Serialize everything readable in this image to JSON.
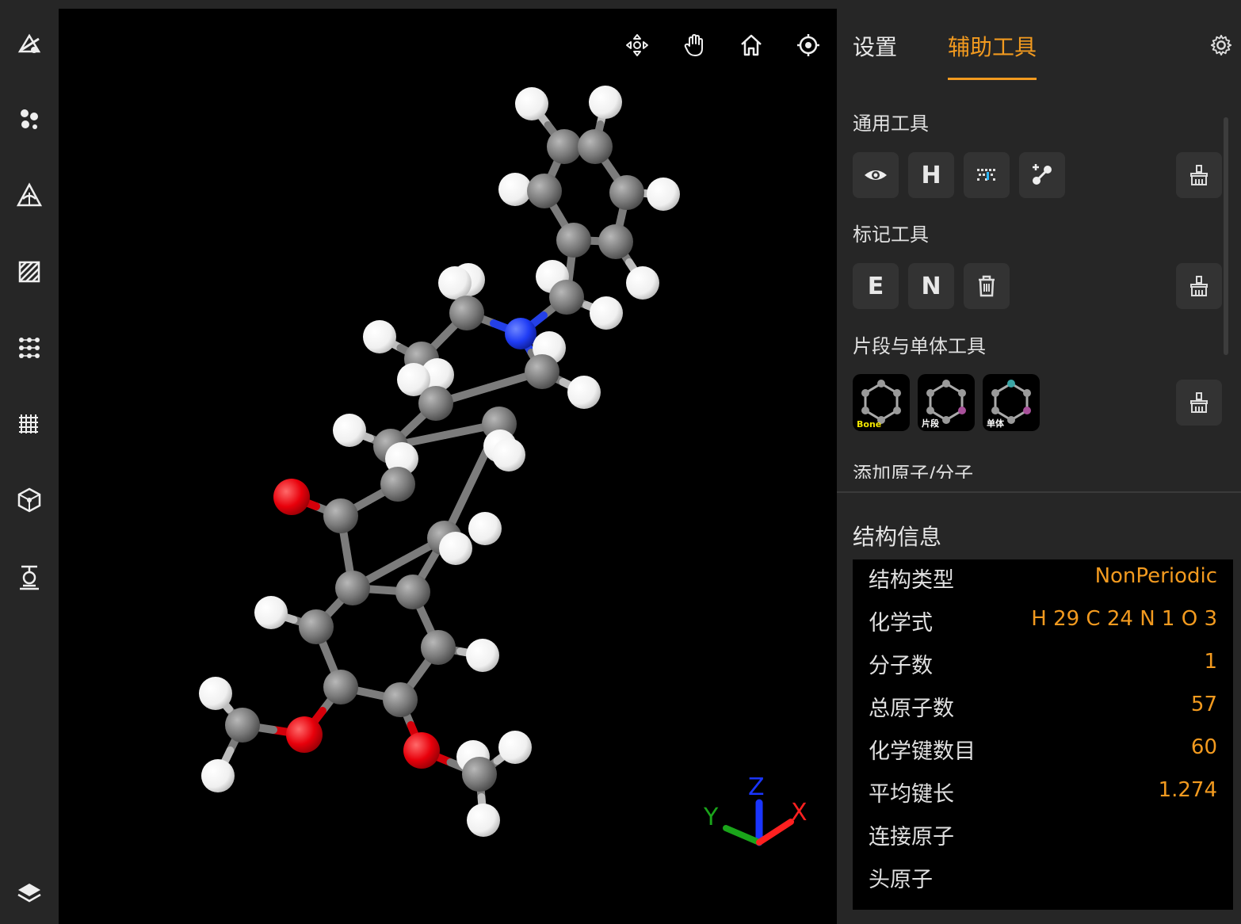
{
  "sidebar": {
    "items": [
      {
        "icon": "build-icon"
      },
      {
        "icon": "molecule-icon"
      },
      {
        "icon": "cone-icon"
      },
      {
        "icon": "surface-icon"
      },
      {
        "icon": "grid-icon"
      },
      {
        "icon": "crystal-icon"
      },
      {
        "icon": "cube-icon"
      },
      {
        "icon": "lab-icon"
      },
      {
        "icon": "layers-icon"
      }
    ]
  },
  "viewer": {
    "toolbar": [
      {
        "icon": "move-icon"
      },
      {
        "icon": "hand-icon"
      },
      {
        "icon": "home-icon"
      },
      {
        "icon": "target-icon"
      }
    ],
    "axes": {
      "x": "X",
      "y": "Y",
      "z": "Z"
    },
    "colors": {
      "carbon": "#7a7a7a",
      "hydrogen": "#ffffff",
      "oxygen": "#e8000b",
      "nitrogen": "#1f3cf5",
      "x_axis": "#ff2020",
      "y_axis": "#1aa41a",
      "z_axis": "#1a35ff"
    }
  },
  "panel": {
    "tabs": {
      "settings": "设置",
      "tools": "辅助工具"
    },
    "sections": {
      "general": "通用工具",
      "marker": "标记工具",
      "fragment": "片段与单体工具",
      "add": "添加原子/分子"
    },
    "general_tools": [
      {
        "icon": "eye-icon"
      },
      {
        "label": "H"
      },
      {
        "icon": "ruler-icon"
      },
      {
        "icon": "bond-edit-icon"
      }
    ],
    "marker_tools": [
      {
        "label": "E"
      },
      {
        "label": "N"
      },
      {
        "icon": "trash-icon"
      }
    ],
    "fragment_tools": [
      {
        "label": "Bone"
      },
      {
        "label": "片段"
      },
      {
        "label": "单体"
      }
    ],
    "structure": {
      "title": "结构信息",
      "rows": [
        {
          "key": "结构类型",
          "value": "NonPeriodic"
        },
        {
          "key": "化学式",
          "value": "H 29 C 24 N 1 O 3"
        },
        {
          "key": "分子数",
          "value": "1"
        },
        {
          "key": "总原子数",
          "value": "57"
        },
        {
          "key": "化学键数目",
          "value": "60"
        },
        {
          "key": "平均键长",
          "value": "1.274"
        },
        {
          "key": "连接原子",
          "value": ""
        },
        {
          "key": "头原子",
          "value": ""
        }
      ]
    },
    "accent_color": "#f29a1f"
  }
}
